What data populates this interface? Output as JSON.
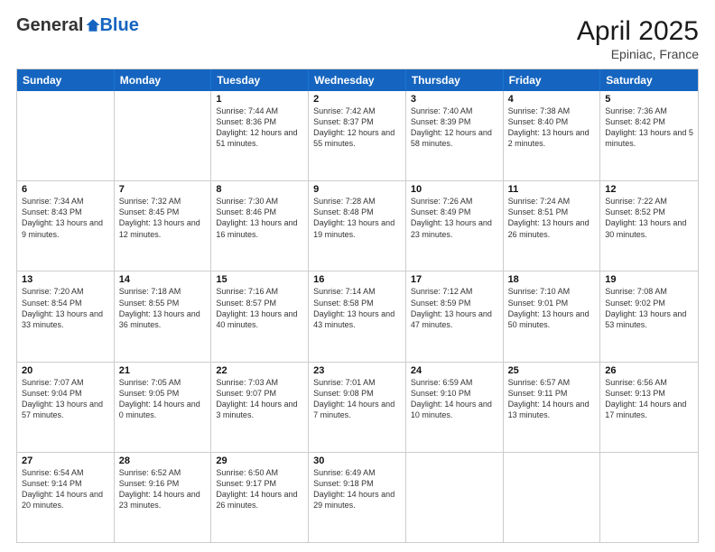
{
  "logo": {
    "general": "General",
    "blue": "Blue"
  },
  "title": "April 2025",
  "subtitle": "Epiniac, France",
  "days": [
    "Sunday",
    "Monday",
    "Tuesday",
    "Wednesday",
    "Thursday",
    "Friday",
    "Saturday"
  ],
  "rows": [
    [
      {
        "day": "",
        "info": ""
      },
      {
        "day": "",
        "info": ""
      },
      {
        "day": "1",
        "info": "Sunrise: 7:44 AM\nSunset: 8:36 PM\nDaylight: 12 hours and 51 minutes."
      },
      {
        "day": "2",
        "info": "Sunrise: 7:42 AM\nSunset: 8:37 PM\nDaylight: 12 hours and 55 minutes."
      },
      {
        "day": "3",
        "info": "Sunrise: 7:40 AM\nSunset: 8:39 PM\nDaylight: 12 hours and 58 minutes."
      },
      {
        "day": "4",
        "info": "Sunrise: 7:38 AM\nSunset: 8:40 PM\nDaylight: 13 hours and 2 minutes."
      },
      {
        "day": "5",
        "info": "Sunrise: 7:36 AM\nSunset: 8:42 PM\nDaylight: 13 hours and 5 minutes."
      }
    ],
    [
      {
        "day": "6",
        "info": "Sunrise: 7:34 AM\nSunset: 8:43 PM\nDaylight: 13 hours and 9 minutes."
      },
      {
        "day": "7",
        "info": "Sunrise: 7:32 AM\nSunset: 8:45 PM\nDaylight: 13 hours and 12 minutes."
      },
      {
        "day": "8",
        "info": "Sunrise: 7:30 AM\nSunset: 8:46 PM\nDaylight: 13 hours and 16 minutes."
      },
      {
        "day": "9",
        "info": "Sunrise: 7:28 AM\nSunset: 8:48 PM\nDaylight: 13 hours and 19 minutes."
      },
      {
        "day": "10",
        "info": "Sunrise: 7:26 AM\nSunset: 8:49 PM\nDaylight: 13 hours and 23 minutes."
      },
      {
        "day": "11",
        "info": "Sunrise: 7:24 AM\nSunset: 8:51 PM\nDaylight: 13 hours and 26 minutes."
      },
      {
        "day": "12",
        "info": "Sunrise: 7:22 AM\nSunset: 8:52 PM\nDaylight: 13 hours and 30 minutes."
      }
    ],
    [
      {
        "day": "13",
        "info": "Sunrise: 7:20 AM\nSunset: 8:54 PM\nDaylight: 13 hours and 33 minutes."
      },
      {
        "day": "14",
        "info": "Sunrise: 7:18 AM\nSunset: 8:55 PM\nDaylight: 13 hours and 36 minutes."
      },
      {
        "day": "15",
        "info": "Sunrise: 7:16 AM\nSunset: 8:57 PM\nDaylight: 13 hours and 40 minutes."
      },
      {
        "day": "16",
        "info": "Sunrise: 7:14 AM\nSunset: 8:58 PM\nDaylight: 13 hours and 43 minutes."
      },
      {
        "day": "17",
        "info": "Sunrise: 7:12 AM\nSunset: 8:59 PM\nDaylight: 13 hours and 47 minutes."
      },
      {
        "day": "18",
        "info": "Sunrise: 7:10 AM\nSunset: 9:01 PM\nDaylight: 13 hours and 50 minutes."
      },
      {
        "day": "19",
        "info": "Sunrise: 7:08 AM\nSunset: 9:02 PM\nDaylight: 13 hours and 53 minutes."
      }
    ],
    [
      {
        "day": "20",
        "info": "Sunrise: 7:07 AM\nSunset: 9:04 PM\nDaylight: 13 hours and 57 minutes."
      },
      {
        "day": "21",
        "info": "Sunrise: 7:05 AM\nSunset: 9:05 PM\nDaylight: 14 hours and 0 minutes."
      },
      {
        "day": "22",
        "info": "Sunrise: 7:03 AM\nSunset: 9:07 PM\nDaylight: 14 hours and 3 minutes."
      },
      {
        "day": "23",
        "info": "Sunrise: 7:01 AM\nSunset: 9:08 PM\nDaylight: 14 hours and 7 minutes."
      },
      {
        "day": "24",
        "info": "Sunrise: 6:59 AM\nSunset: 9:10 PM\nDaylight: 14 hours and 10 minutes."
      },
      {
        "day": "25",
        "info": "Sunrise: 6:57 AM\nSunset: 9:11 PM\nDaylight: 14 hours and 13 minutes."
      },
      {
        "day": "26",
        "info": "Sunrise: 6:56 AM\nSunset: 9:13 PM\nDaylight: 14 hours and 17 minutes."
      }
    ],
    [
      {
        "day": "27",
        "info": "Sunrise: 6:54 AM\nSunset: 9:14 PM\nDaylight: 14 hours and 20 minutes."
      },
      {
        "day": "28",
        "info": "Sunrise: 6:52 AM\nSunset: 9:16 PM\nDaylight: 14 hours and 23 minutes."
      },
      {
        "day": "29",
        "info": "Sunrise: 6:50 AM\nSunset: 9:17 PM\nDaylight: 14 hours and 26 minutes."
      },
      {
        "day": "30",
        "info": "Sunrise: 6:49 AM\nSunset: 9:18 PM\nDaylight: 14 hours and 29 minutes."
      },
      {
        "day": "",
        "info": ""
      },
      {
        "day": "",
        "info": ""
      },
      {
        "day": "",
        "info": ""
      }
    ]
  ]
}
